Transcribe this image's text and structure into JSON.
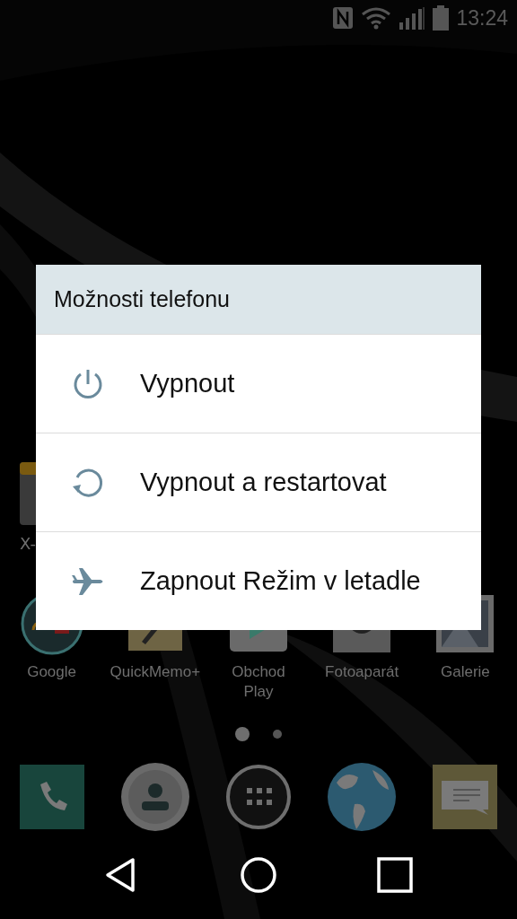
{
  "status_bar": {
    "time": "13:24"
  },
  "home": {
    "partial_app": {
      "label": "X-"
    },
    "apps": [
      {
        "label": "Google",
        "kind": "folder"
      },
      {
        "label": "QuickMemo+",
        "kind": "memo"
      },
      {
        "label": "Obchod Play",
        "kind": "store"
      },
      {
        "label": "Fotoaparát",
        "kind": "camera"
      },
      {
        "label": "Galerie",
        "kind": "gallery"
      }
    ],
    "page_dots": [
      {
        "selected": true
      },
      {
        "selected": false
      }
    ],
    "dock": [
      {
        "kind": "phone"
      },
      {
        "kind": "contacts"
      },
      {
        "kind": "apps"
      },
      {
        "kind": "globe"
      },
      {
        "kind": "messages"
      }
    ]
  },
  "dialog": {
    "title": "Možnosti telefonu",
    "options": [
      {
        "label": "Vypnout",
        "kind": "power"
      },
      {
        "label": "Vypnout a restartovat",
        "kind": "restart"
      },
      {
        "label": "Zapnout Režim v letadle",
        "kind": "airplane"
      }
    ]
  }
}
